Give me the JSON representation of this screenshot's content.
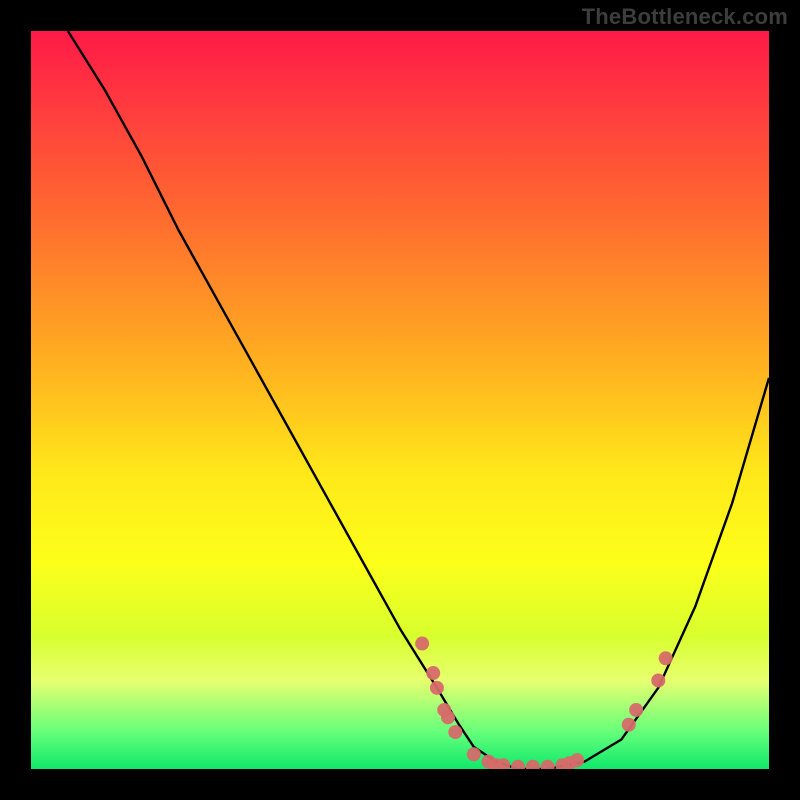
{
  "watermark": {
    "text": "TheBottleneck.com"
  },
  "colors": {
    "background": "#000000",
    "gradient_top": "#ff1a47",
    "gradient_bottom": "#10e86a",
    "curve": "#000000",
    "dot": "#d66a6a"
  },
  "chart_data": {
    "type": "line",
    "title": "",
    "xlabel": "",
    "ylabel": "",
    "xlim": [
      0,
      100
    ],
    "ylim": [
      0,
      100
    ],
    "grid": false,
    "series": [
      {
        "name": "bottleneck-curve",
        "x": [
          5,
          10,
          15,
          20,
          25,
          30,
          35,
          40,
          45,
          50,
          55,
          58,
          60,
          63,
          66,
          70,
          75,
          80,
          85,
          90,
          95,
          100
        ],
        "y": [
          100,
          92,
          83,
          73,
          64,
          55,
          46,
          37,
          28,
          19,
          11,
          6,
          3,
          1,
          0,
          0,
          1,
          4,
          11,
          22,
          36,
          53
        ]
      }
    ],
    "scatter": [
      {
        "name": "marker",
        "x": 53,
        "y": 17
      },
      {
        "name": "marker",
        "x": 54.5,
        "y": 13
      },
      {
        "name": "marker",
        "x": 55,
        "y": 11
      },
      {
        "name": "marker",
        "x": 56,
        "y": 8
      },
      {
        "name": "marker",
        "x": 56.5,
        "y": 7
      },
      {
        "name": "marker",
        "x": 57.5,
        "y": 5
      },
      {
        "name": "marker",
        "x": 60,
        "y": 2
      },
      {
        "name": "marker",
        "x": 62,
        "y": 1
      },
      {
        "name": "marker",
        "x": 63,
        "y": 0.5
      },
      {
        "name": "marker",
        "x": 64,
        "y": 0.5
      },
      {
        "name": "marker",
        "x": 66,
        "y": 0.3
      },
      {
        "name": "marker",
        "x": 68,
        "y": 0.3
      },
      {
        "name": "marker",
        "x": 70,
        "y": 0.3
      },
      {
        "name": "marker",
        "x": 72,
        "y": 0.5
      },
      {
        "name": "marker",
        "x": 73,
        "y": 0.8
      },
      {
        "name": "marker",
        "x": 74,
        "y": 1.2
      },
      {
        "name": "marker",
        "x": 81,
        "y": 6
      },
      {
        "name": "marker",
        "x": 82,
        "y": 8
      },
      {
        "name": "marker",
        "x": 85,
        "y": 12
      },
      {
        "name": "marker",
        "x": 86,
        "y": 15
      }
    ]
  }
}
